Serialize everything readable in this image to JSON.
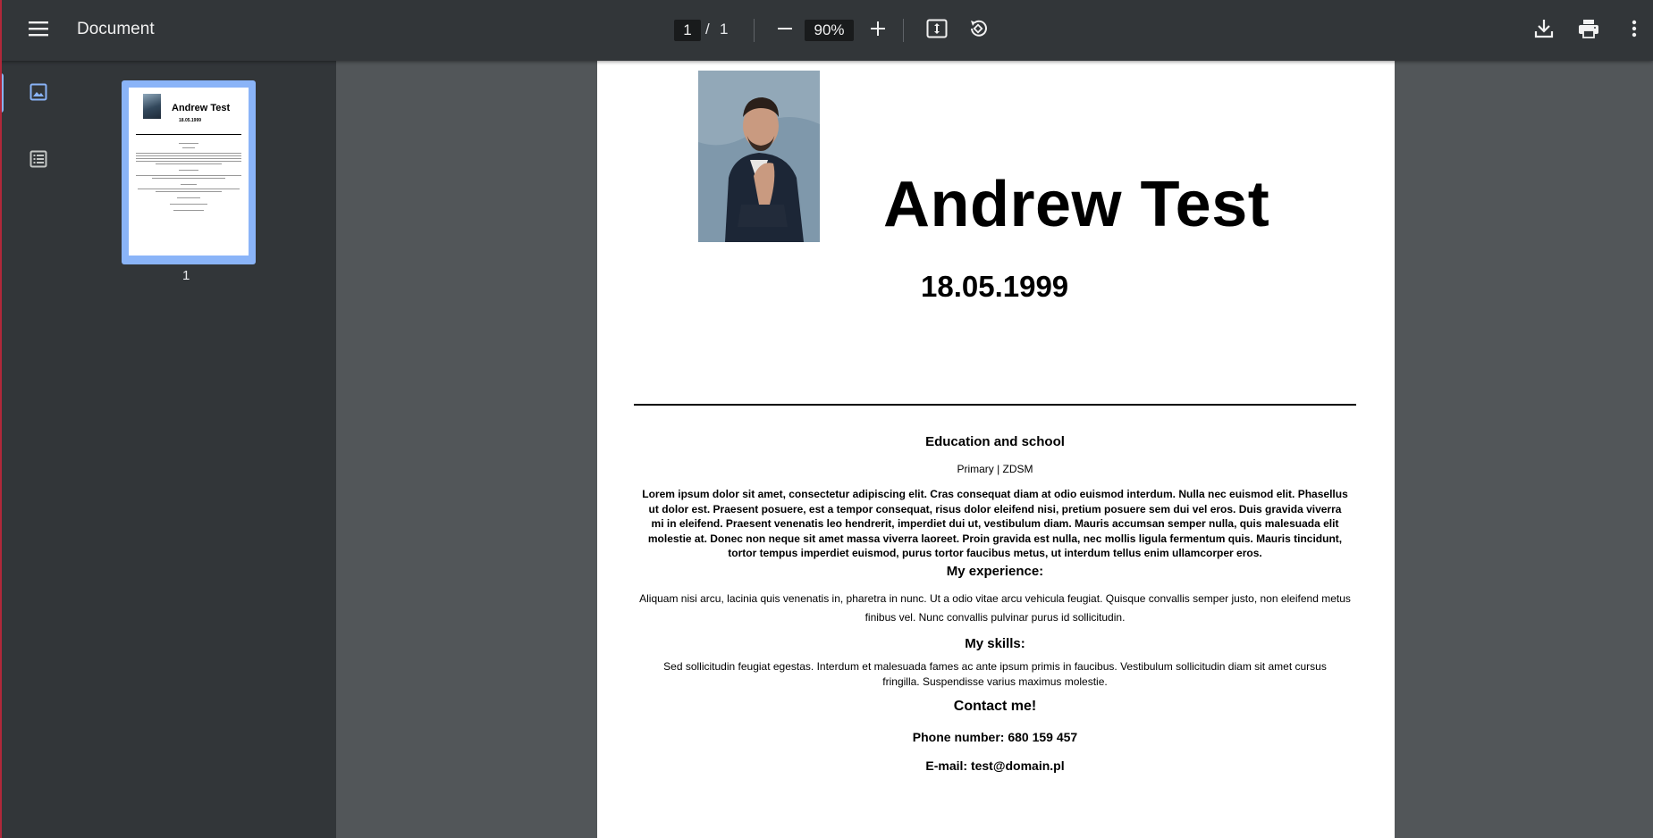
{
  "toolbar": {
    "title": "Document",
    "current_page": "1",
    "page_separator": "/",
    "total_pages": "1",
    "zoom": "90%",
    "icons": [
      "menu-icon",
      "zoom-out-icon",
      "zoom-in-icon",
      "fit-to-page-icon",
      "rotate-icon",
      "download-icon",
      "print-icon",
      "more-icon"
    ]
  },
  "sidebar": {
    "icons": [
      "thumbnail-icon",
      "outline-icon"
    ],
    "thumbnail": {
      "label": "1",
      "name": "Andrew Test",
      "date": "18.05.1999"
    }
  },
  "document": {
    "name": "Andrew Test",
    "dob": "18.05.1999",
    "education_heading": "Education and school",
    "school": "Primary | ZDSM",
    "education_text": "Lorem ipsum dolor sit amet, consectetur adipiscing elit. Cras consequat diam at odio euismod interdum. Nulla nec euismod elit. Phasellus ut dolor est. Praesent posuere, est a tempor consequat, risus dolor eleifend nisi, pretium posuere sem dui vel eros. Duis gravida viverra mi in eleifend. Praesent venenatis leo hendrerit, imperdiet dui ut, vestibulum diam. Mauris accumsan semper nulla, quis malesuada elit molestie at. Donec non neque sit amet massa viverra laoreet. Proin gravida est nulla, nec mollis ligula fermentum quis. Mauris tincidunt, tortor tempus imperdiet euismod, purus tortor faucibus metus, ut interdum tellus enim ullamcorper eros.",
    "experience_heading": "My experience:",
    "experience_text": "Aliquam nisi arcu, lacinia quis venenatis in, pharetra in nunc. Ut a odio vitae arcu vehicula feugiat. Quisque convallis semper justo, non eleifend metus finibus vel. Nunc convallis pulvinar purus id sollicitudin.",
    "skills_heading": "My skills:",
    "skills_text": "Sed sollicitudin feugiat egestas. Interdum et malesuada fames ac ante ipsum primis in faucibus. Vestibulum sollicitudin diam sit amet cursus fringilla. Suspendisse varius maximus molestie.",
    "contact_heading": "Contact me!",
    "phone": "Phone number: 680 159 457",
    "email": "E-mail: test@domain.pl"
  },
  "colors": {
    "toolbar_bg": "#323639",
    "viewer_bg": "#525659",
    "accent": "#8ab4f8"
  }
}
